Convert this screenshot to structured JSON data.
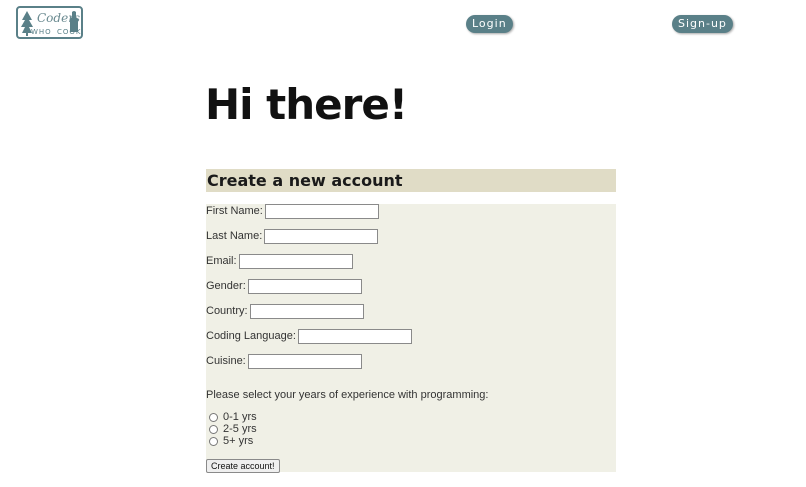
{
  "logo": {
    "line1": "Coders",
    "line2_left": "WHO",
    "line2_right": "COOK"
  },
  "nav": {
    "login": "Login",
    "signup": "Sign-up"
  },
  "greeting": "Hi there!",
  "form": {
    "title": "Create a new account",
    "fields": [
      {
        "label": "First Name:",
        "value": ""
      },
      {
        "label": "Last Name:",
        "value": ""
      },
      {
        "label": "Email:",
        "value": ""
      },
      {
        "label": "Gender:",
        "value": ""
      },
      {
        "label": "Country:",
        "value": ""
      },
      {
        "label": "Coding Language:",
        "value": ""
      },
      {
        "label": "Cuisine:",
        "value": ""
      }
    ],
    "experience_question": "Please select your years of experience with programming:",
    "experience_options": [
      "0-1 yrs",
      "2-5 yrs",
      "5+ yrs"
    ],
    "submit": "Create account!"
  }
}
